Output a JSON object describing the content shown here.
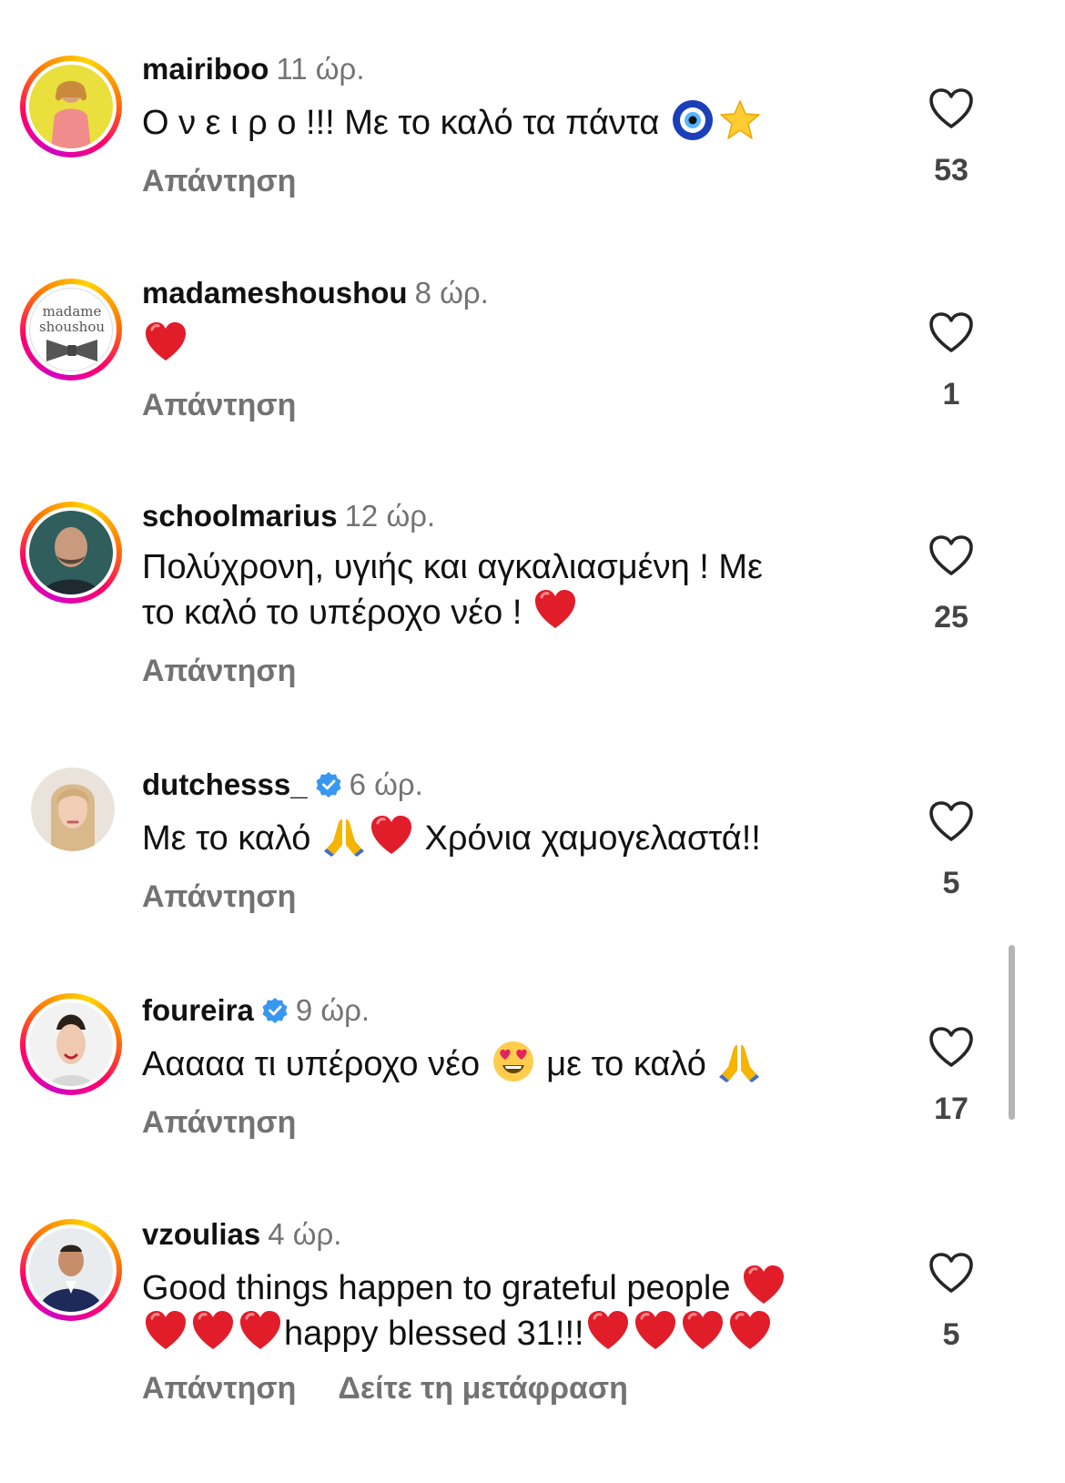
{
  "comments": [
    {
      "username": "mairiboo",
      "time": "11 ώρ.",
      "text": "Ο ν ε ι ρ ο !!! Με το καλό τα πάντα",
      "reply": "Απάντηση",
      "likes": "53"
    },
    {
      "username": "madameshoushou",
      "time": "8 ώρ.",
      "avatar_text_1": "madame",
      "avatar_text_2": "shoushou",
      "reply": "Απάντηση",
      "likes": "1"
    },
    {
      "username": "schoolmarius",
      "time": "12 ώρ.",
      "text_line1": "Πολύχρονη, υγιής και αγκαλιασμένη ! Με",
      "text_line2": "το καλό το υπέροχο νέο !",
      "reply": "Απάντηση",
      "likes": "25"
    },
    {
      "username": "dutchesss_",
      "time": "6 ώρ.",
      "text_a": "Με το καλό",
      "text_b": "Χρόνια χαμογελαστά!!",
      "reply": "Απάντηση",
      "likes": "5"
    },
    {
      "username": "foureira",
      "time": "9 ώρ.",
      "text_a": "Ααααα τι υπέροχο νέο",
      "text_b": "με το καλό",
      "reply": "Απάντηση",
      "likes": "17"
    },
    {
      "username": "vzoulias",
      "time": "4 ώρ.",
      "text_line1": "Good things happen to grateful people",
      "text_line2": "happy blessed 31!!!",
      "reply": "Απάντηση",
      "translate": "Δείτε τη μετάφραση",
      "likes": "5"
    }
  ],
  "icons": {
    "like": "heart-outline-icon",
    "verified": "verified-badge-icon"
  },
  "colors": {
    "secondary_text": "#737373",
    "verified": "#3897f0",
    "heart_emoji": "#e11d2a"
  }
}
